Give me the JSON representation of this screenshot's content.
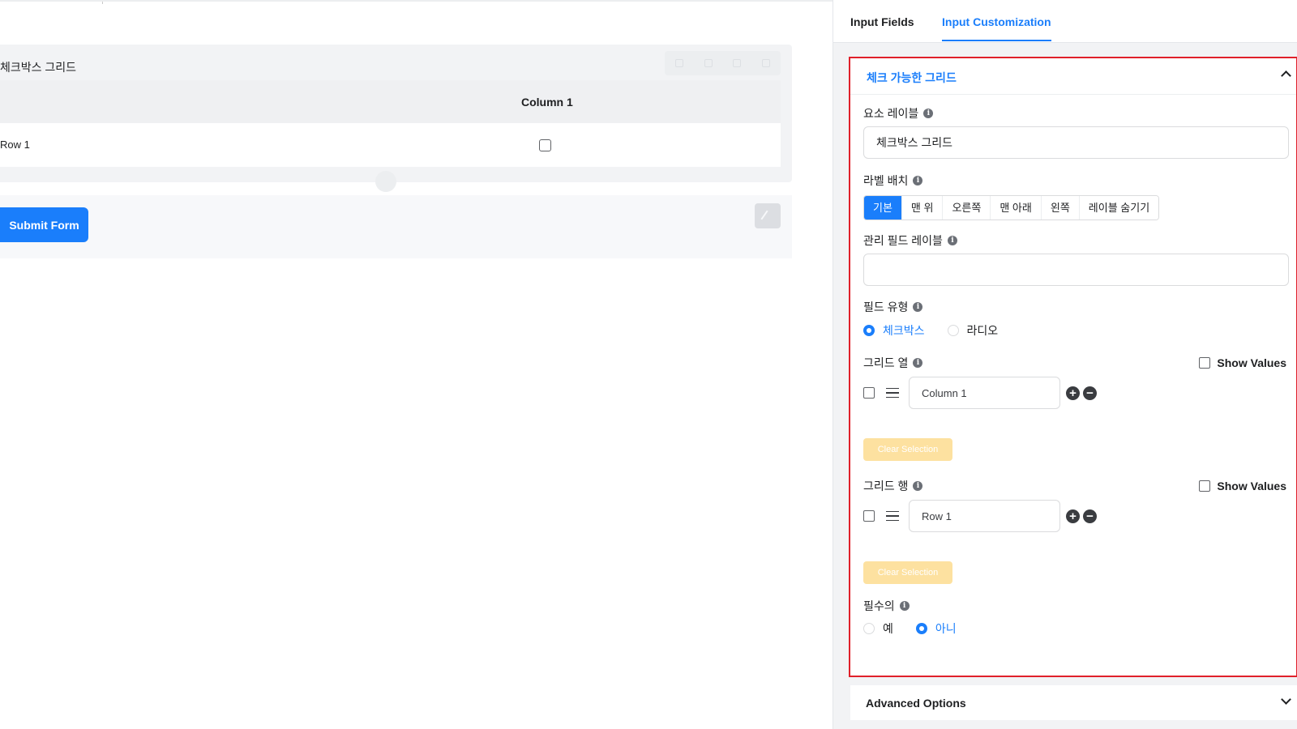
{
  "form_preview": {
    "element_title": "체크박스 그리드",
    "grid_column": "Column 1",
    "grid_row": "Row 1",
    "submit_label": "Submit Form"
  },
  "tabs": [
    "Input Fields",
    "Input Customization"
  ],
  "active_tab": "Input Customization",
  "panel": {
    "title": "체크 가능한 그리드",
    "element_label": {
      "label": "요소 레이블",
      "value": "체크박스 그리드"
    },
    "label_placement": {
      "label": "라벨 배치",
      "options": [
        "기본",
        "맨 위",
        "오른쪽",
        "맨 아래",
        "왼쪽",
        "레이블 숨기기"
      ],
      "selected": "기본"
    },
    "admin_field_label": {
      "label": "관리 필드 레이블",
      "value": ""
    },
    "field_type": {
      "label": "필드 유형",
      "options": [
        "체크박스",
        "라디오"
      ],
      "selected": "체크박스"
    },
    "grid_columns": {
      "label": "그리드 열",
      "show_values_label": "Show Values",
      "items": [
        "Column 1"
      ],
      "clear_label": "Clear Selection"
    },
    "grid_rows": {
      "label": "그리드 행",
      "show_values_label": "Show Values",
      "items": [
        "Row 1"
      ],
      "clear_label": "Clear Selection"
    },
    "required": {
      "label": "필수의",
      "options": [
        "예",
        "아니"
      ],
      "selected": "아니"
    }
  },
  "advanced_options": {
    "title": "Advanced Options"
  },
  "info_glyph": "i",
  "icons": {
    "plus": "+",
    "minus": "−"
  },
  "colors": {
    "accent": "#1a7efb",
    "highlight_border": "#e0202a",
    "clear_button": "#fde1a0"
  }
}
